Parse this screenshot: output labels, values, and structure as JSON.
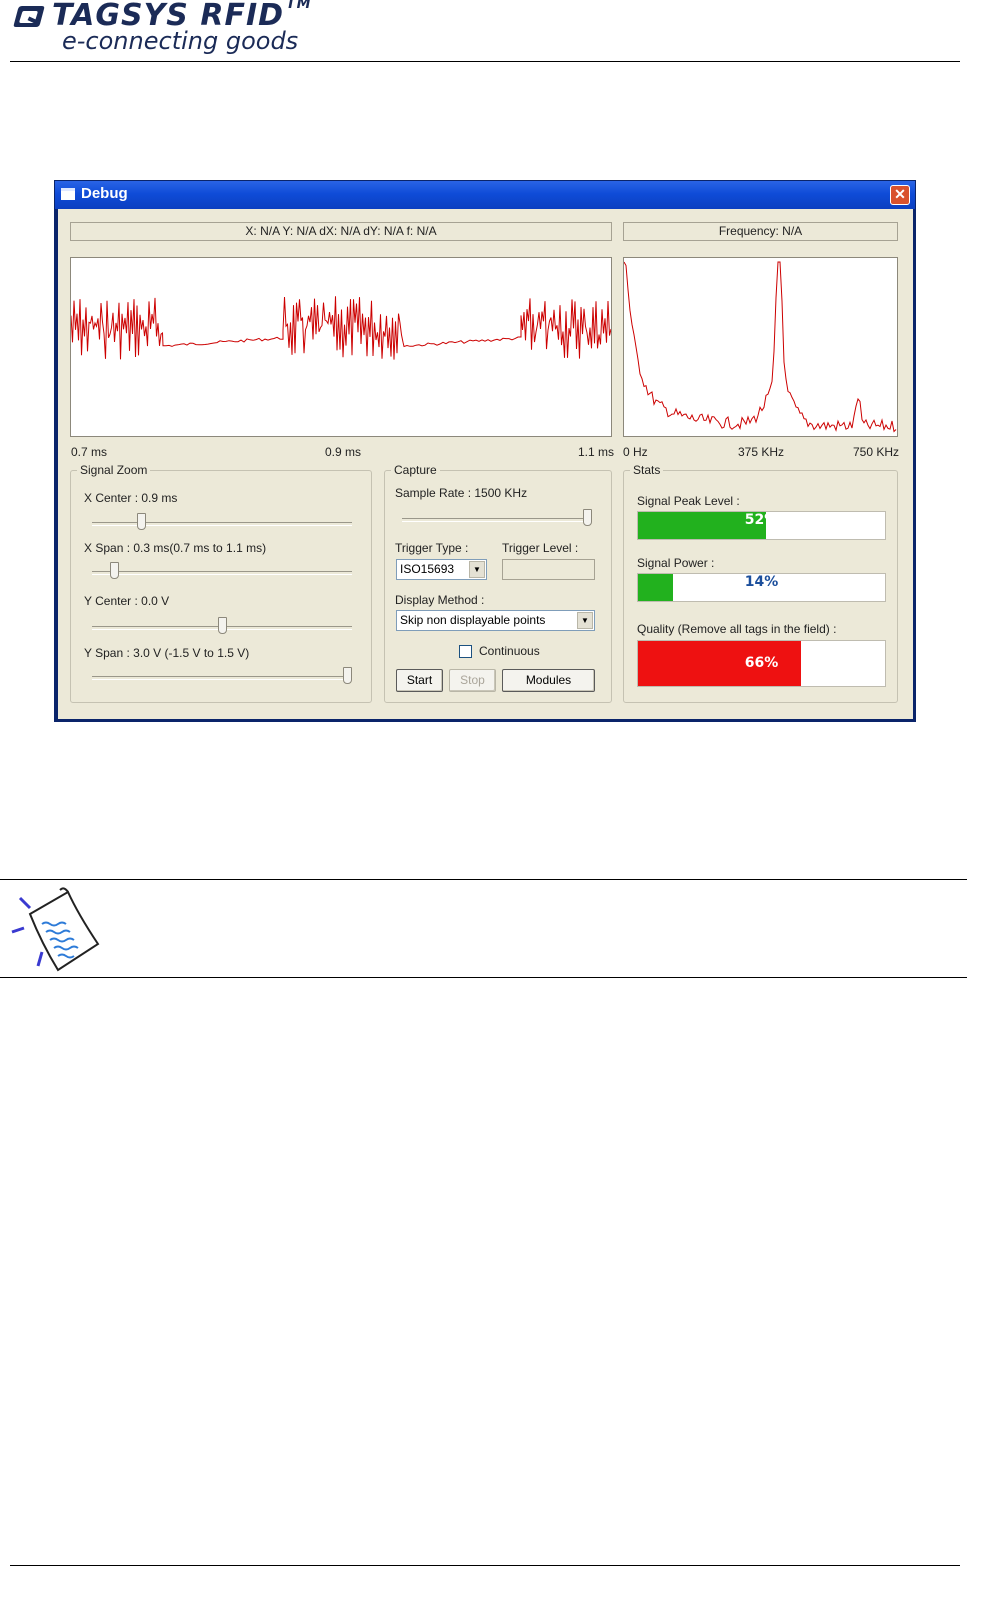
{
  "header": {
    "brand": "TAGSYS RFID",
    "trademark": "TM",
    "tagline": "e-connecting goods"
  },
  "window": {
    "title": "Debug",
    "close_glyph": "✕"
  },
  "readouts": {
    "cursor": "X: N/A   Y: N/A   dX: N/A   dY: N/A   f: N/A",
    "frequency": "Frequency: N/A"
  },
  "time_axis": {
    "left": "0.7 ms",
    "mid": "0.9 ms",
    "right": "1.1 ms"
  },
  "freq_axis": {
    "left": "0 Hz",
    "mid": "375 KHz",
    "right": "750 KHz"
  },
  "signal_zoom": {
    "legend": "Signal Zoom",
    "x_center": {
      "label": "X Center : 0.9 ms",
      "position": 0.18
    },
    "x_span": {
      "label": "X Span : 0.3 ms(0.7 ms to 1.1 ms)",
      "position": 0.07
    },
    "y_center": {
      "label": "Y Center : 0.0 V",
      "position": 0.5
    },
    "y_span": {
      "label": "Y Span : 3.0 V (-1.5 V to 1.5 V)",
      "position": 1.0
    }
  },
  "capture": {
    "legend": "Capture",
    "sample_rate": {
      "label": "Sample Rate : 1500 KHz",
      "position": 1.0
    },
    "trigger_type_label": "Trigger Type :",
    "trigger_type_value": "ISO15693",
    "trigger_level_label": "Trigger Level :",
    "display_method_label": "Display Method :",
    "display_method_value": "Skip non displayable points",
    "continuous_label": "Continuous",
    "start_label": "Start",
    "stop_label": "Stop",
    "modules_label": "Modules"
  },
  "stats": {
    "legend": "Stats",
    "signal_peak": {
      "label": "Signal Peak Level :",
      "value": 52,
      "text": "52%",
      "color": "#22b11e"
    },
    "signal_power": {
      "label": "Signal Power :",
      "value": 14,
      "text": "14%",
      "color": "#22b11e"
    },
    "quality": {
      "label": "Quality (Remove all tags in the field) :",
      "value": 66,
      "text": "66%",
      "color": "#ee1111"
    }
  },
  "colors": {
    "trace": "#cc0000",
    "pct_text_light": "#1c4f9c",
    "pct_text_dark": "#ffffff"
  },
  "icons": {
    "note": "note-paper-icon",
    "logo": "tagsys-logo-icon"
  }
}
